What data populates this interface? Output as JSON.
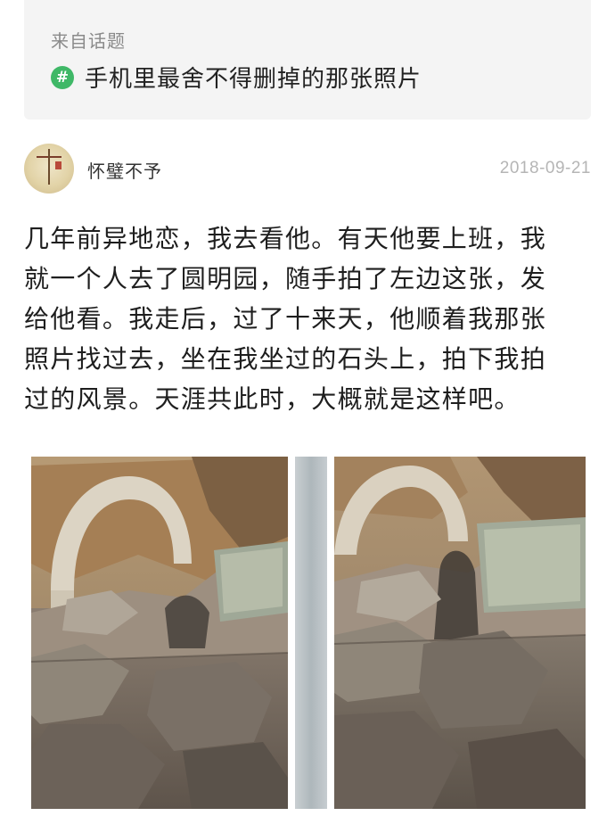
{
  "topic": {
    "from_label": "来自话题",
    "hash_symbol": "#",
    "title": "手机里最舍不得删掉的那张照片",
    "accent_color": "#3fb867"
  },
  "author": {
    "name": "怀璧不予",
    "date": "2018-09-21"
  },
  "post": {
    "lines": [
      "几年前异地恋，我去看他。有天他要上班，我",
      "就一个人去了圆明园，随手拍了左边这张，发",
      "给他看。我走后，过了十来天，他顺着我那张",
      "照片找过去，坐在我坐过的石头上，拍下我拍",
      "过的风景。天涯共此时，大概就是这样吧。"
    ]
  },
  "photos": [
    {
      "name": "photo-left",
      "subject": "stone arch ruins with tablet and shadow"
    },
    {
      "name": "photo-right",
      "subject": "stone arch ruins with tablet and shadow"
    }
  ]
}
